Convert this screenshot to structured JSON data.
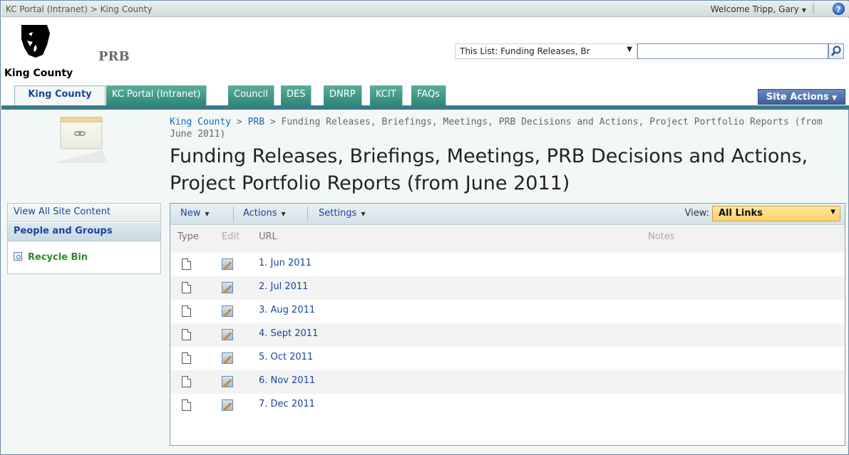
{
  "globalbar": {
    "crumb": "KC Portal (Intranet) > King County",
    "welcome": "Welcome Tripp, Gary",
    "separator": "|",
    "help_icon": "help-icon"
  },
  "header": {
    "logo_text": "King County",
    "site_title": "PRB",
    "search_scope": "This List: Funding Releases, Br",
    "search_icon": "search-icon"
  },
  "tabs": [
    {
      "label": "King County"
    },
    {
      "label": "KC Portal (Intranet)"
    },
    {
      "label": "Council"
    },
    {
      "label": "DES"
    },
    {
      "label": "DNRP"
    },
    {
      "label": "KCIT"
    },
    {
      "label": "FAQs"
    }
  ],
  "site_actions": "Site Actions",
  "breadcrumb": {
    "part1": "King County",
    "sep1": " > ",
    "part2": "PRB",
    "sep2": " > ",
    "current": "Funding Releases, Briefings, Meetings, PRB Decisions and Actions, Project Portfolio Reports (from June 2011)"
  },
  "page_title": "Funding Releases, Briefings, Meetings, PRB Decisions and Actions, Project Portfolio Reports (from June 2011)",
  "quicklaunch": {
    "view_all": "View All Site Content",
    "people": "People and Groups",
    "recycle": "Recycle Bin"
  },
  "toolbar": {
    "new": "New",
    "actions": "Actions",
    "settings": "Settings",
    "view_label": "View:",
    "view_value": "All Links"
  },
  "table": {
    "headers": {
      "type": "Type",
      "edit": "Edit",
      "url": "URL",
      "notes": "Notes"
    },
    "rows": [
      {
        "url": "1. Jun 2011"
      },
      {
        "url": "2. Jul 2011"
      },
      {
        "url": "3. Aug 2011"
      },
      {
        "url": "4. Sept 2011"
      },
      {
        "url": "5. Oct 2011"
      },
      {
        "url": "6. Nov 2011"
      },
      {
        "url": "7. Dec 2011"
      }
    ]
  }
}
